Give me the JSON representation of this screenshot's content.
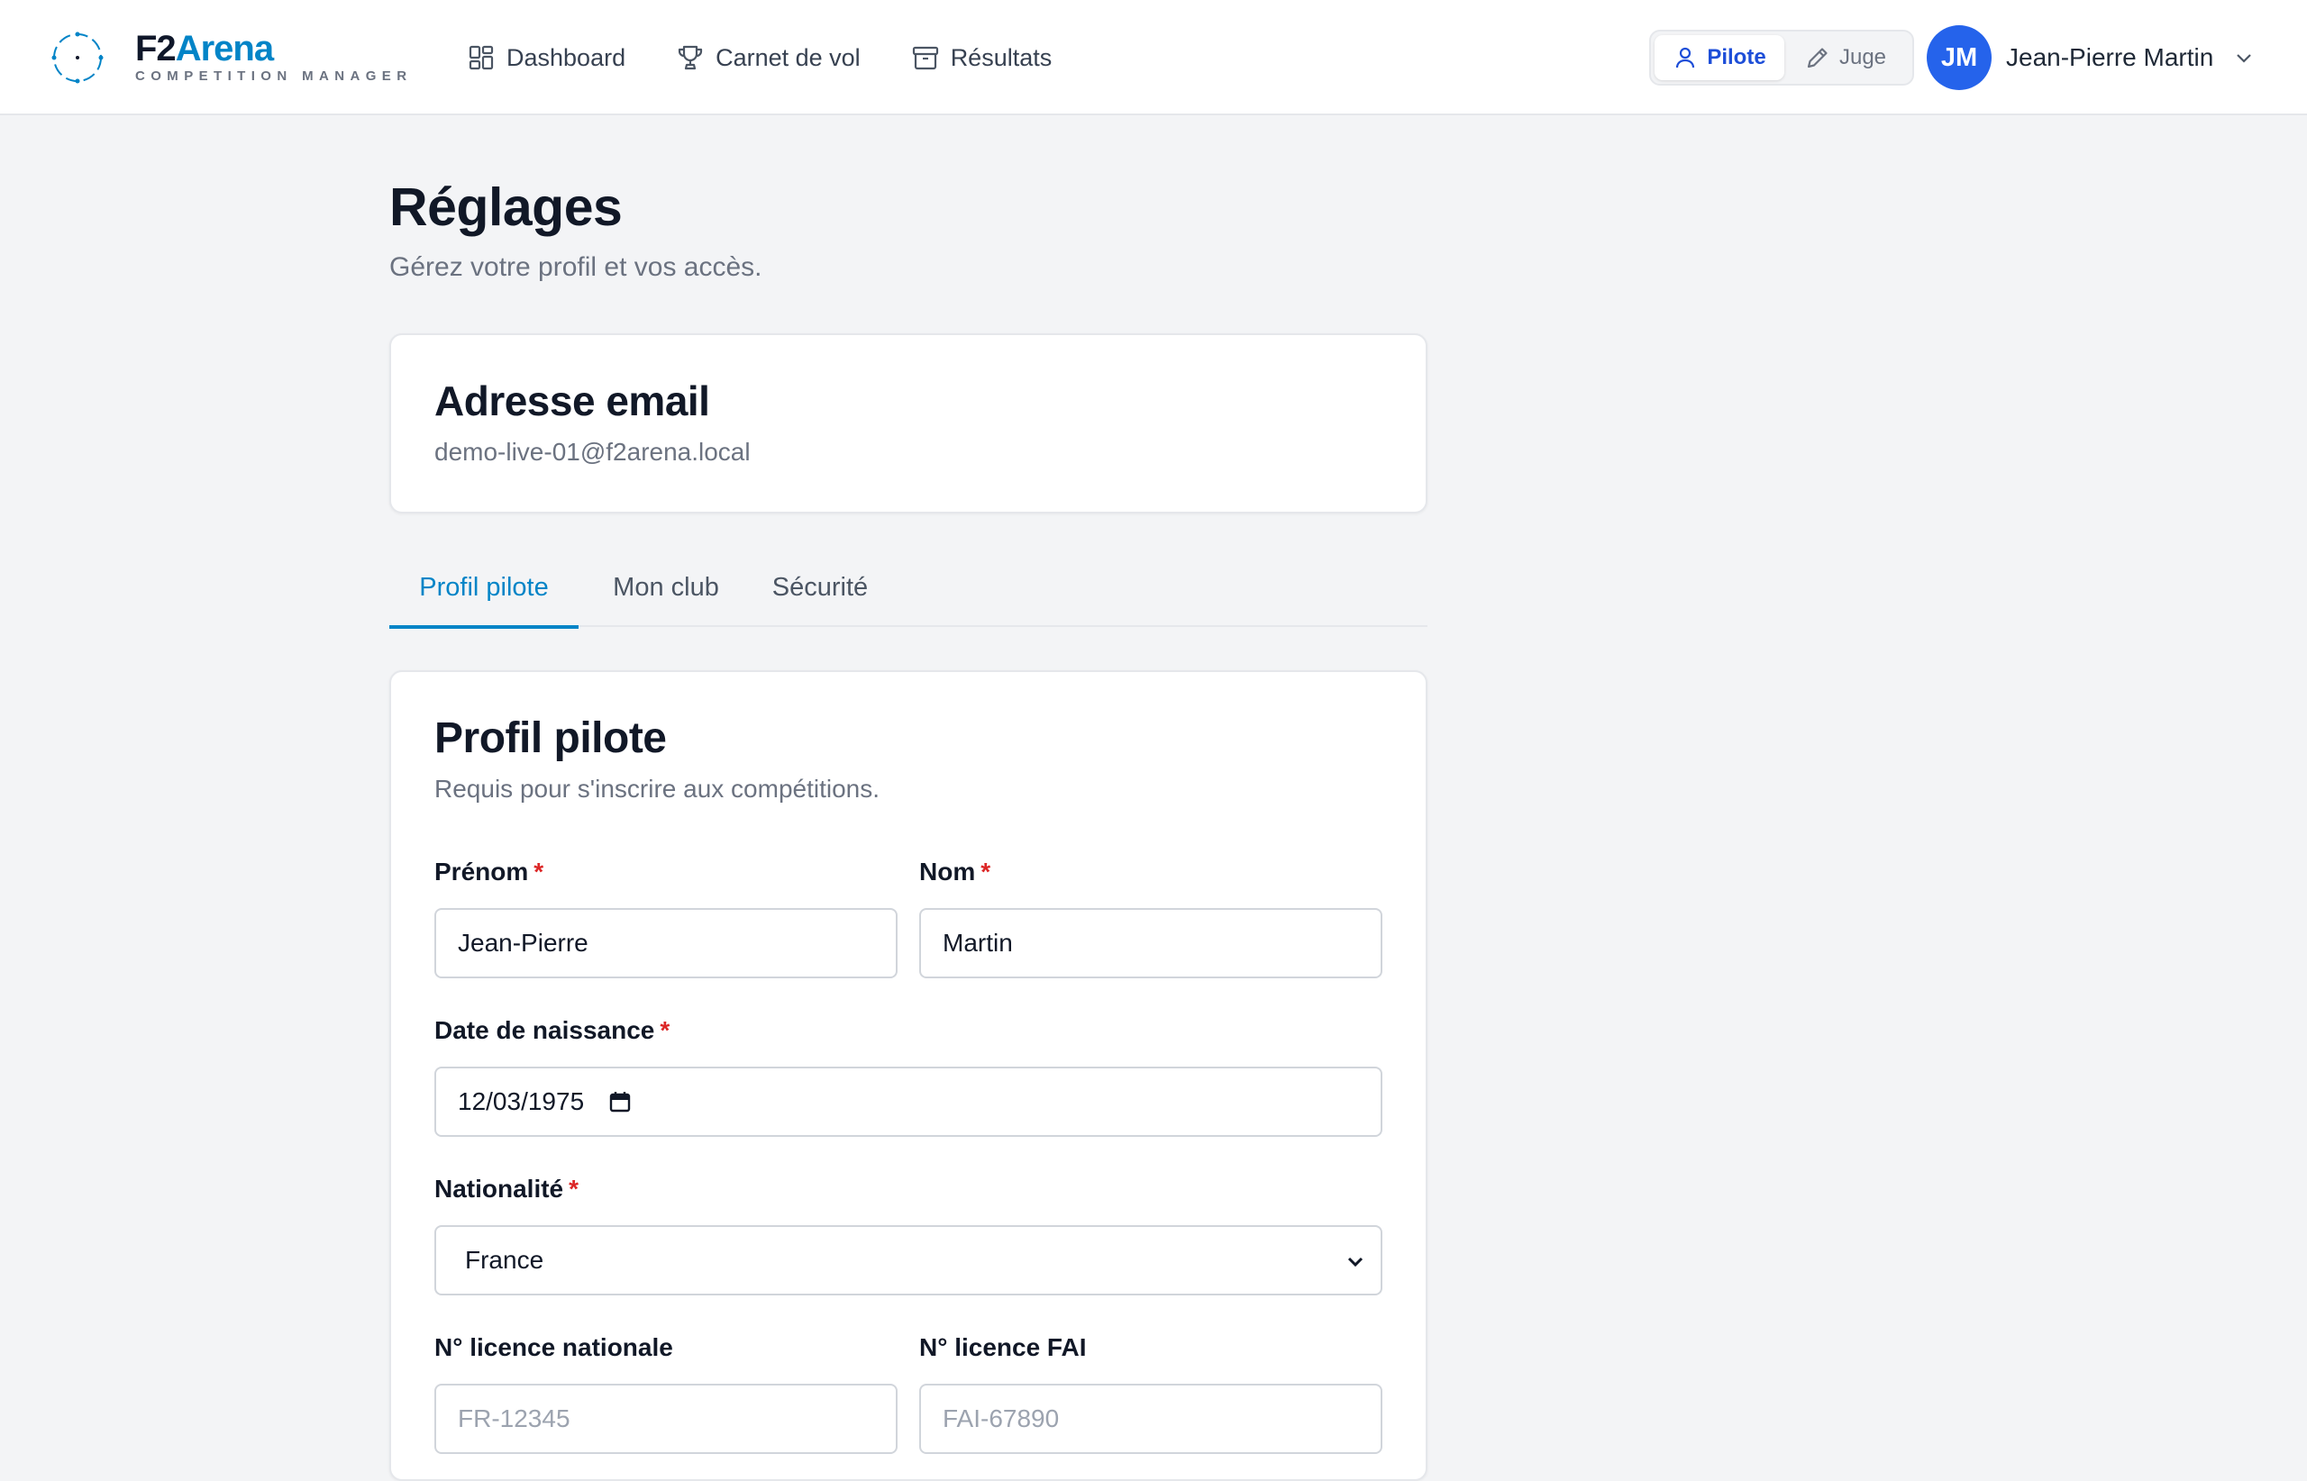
{
  "brand": {
    "name_part1": "F2",
    "name_part2": "Arena",
    "tagline": "COMPETITION MANAGER"
  },
  "nav": {
    "items": [
      {
        "label": "Dashboard",
        "icon": "grid-icon"
      },
      {
        "label": "Carnet de vol",
        "icon": "trophy-icon"
      },
      {
        "label": "Résultats",
        "icon": "archive-icon"
      }
    ]
  },
  "roles": {
    "pilot_label": "Pilote",
    "judge_label": "Juge",
    "active": "Pilote"
  },
  "user": {
    "initials": "JM",
    "name": "Jean-Pierre Martin"
  },
  "page": {
    "title": "Réglages",
    "subtitle": "Gérez votre profil et vos accès."
  },
  "email_card": {
    "title": "Adresse email",
    "value": "demo-live-01@f2arena.local"
  },
  "tabs": [
    {
      "label": "Profil pilote",
      "active": true
    },
    {
      "label": "Mon club",
      "active": false
    },
    {
      "label": "Sécurité",
      "active": false
    }
  ],
  "profile": {
    "title": "Profil pilote",
    "subtitle": "Requis pour s'inscrire aux compétitions.",
    "required_marker": "*",
    "fields": {
      "first_name": {
        "label": "Prénom",
        "value": "Jean-Pierre"
      },
      "last_name": {
        "label": "Nom",
        "value": "Martin"
      },
      "birth_date": {
        "label": "Date de naissance",
        "value": "12/03/1975"
      },
      "nationality": {
        "label": "Nationalité",
        "value": "France"
      },
      "national_license": {
        "label": "N° licence nationale",
        "placeholder": "FR-12345"
      },
      "fai_license": {
        "label": "N° licence FAI",
        "placeholder": "FAI-67890"
      }
    }
  },
  "colors": {
    "accent": "#0284c7",
    "primary": "#2563eb",
    "required": "#dc2626"
  }
}
